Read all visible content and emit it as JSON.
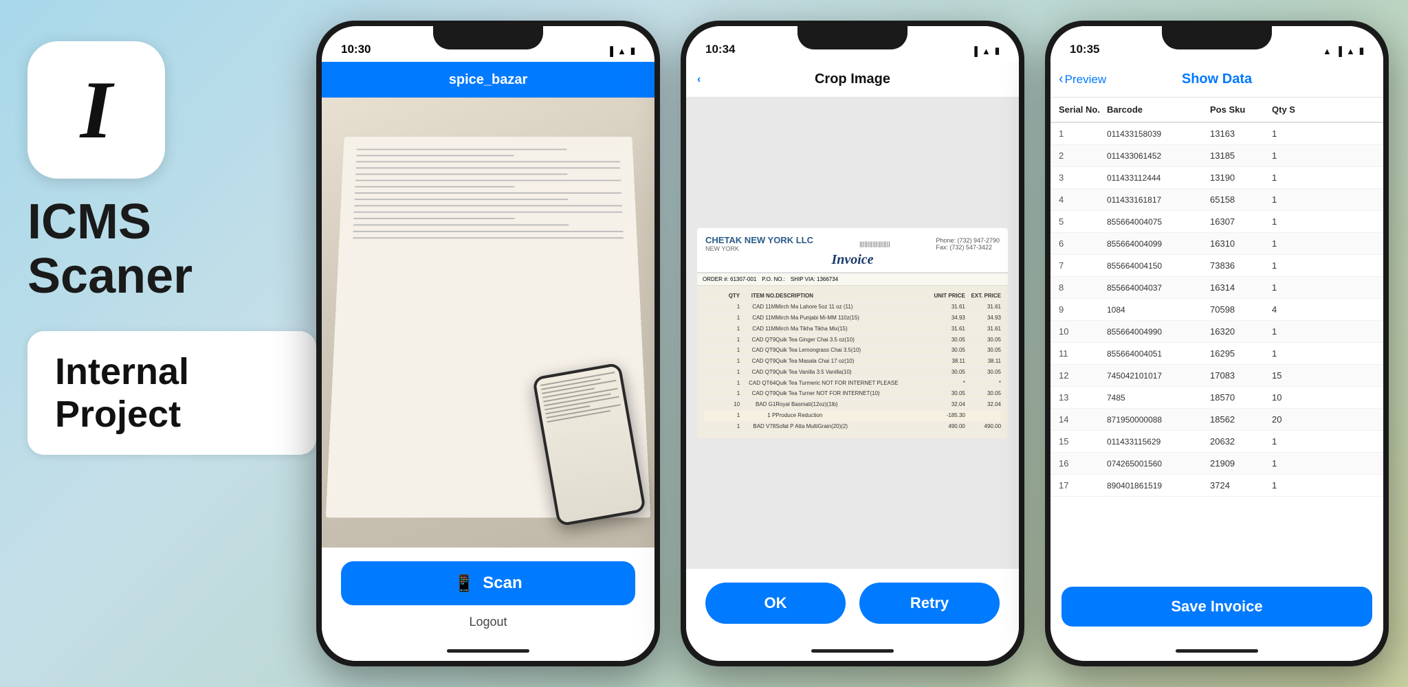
{
  "background": "#b8d4d8",
  "app": {
    "icon_letter": "I",
    "name": "ICMS\nScaner",
    "badge": "Internal Project"
  },
  "phone1": {
    "time": "10:30",
    "nav_title": "spice_bazar",
    "scan_button": "Scan",
    "logout": "Logout"
  },
  "phone2": {
    "time": "10:34",
    "nav_title": "Crop Image",
    "ok_button": "OK",
    "retry_button": "Retry"
  },
  "phone3": {
    "time": "10:35",
    "nav_back": "Preview",
    "nav_title": "Show Data",
    "columns": [
      "Serial No.",
      "Barcode",
      "Pos Sku",
      "Qty S"
    ],
    "rows": [
      {
        "serial": "1",
        "barcode": "011433158039",
        "pos": "13163",
        "qty": "1"
      },
      {
        "serial": "2",
        "barcode": "011433061452",
        "pos": "13185",
        "qty": "1"
      },
      {
        "serial": "3",
        "barcode": "011433112444",
        "pos": "13190",
        "qty": "1"
      },
      {
        "serial": "4",
        "barcode": "011433161817",
        "pos": "65158",
        "qty": "1"
      },
      {
        "serial": "5",
        "barcode": "855664004075",
        "pos": "16307",
        "qty": "1"
      },
      {
        "serial": "6",
        "barcode": "855664004099",
        "pos": "16310",
        "qty": "1"
      },
      {
        "serial": "7",
        "barcode": "855664004150",
        "pos": "73836",
        "qty": "1"
      },
      {
        "serial": "8",
        "barcode": "855664004037",
        "pos": "16314",
        "qty": "1"
      },
      {
        "serial": "9",
        "barcode": "1084",
        "pos": "70598",
        "qty": "4"
      },
      {
        "serial": "10",
        "barcode": "855664004990",
        "pos": "16320",
        "qty": "1"
      },
      {
        "serial": "11",
        "barcode": "855664004051",
        "pos": "16295",
        "qty": "1"
      },
      {
        "serial": "12",
        "barcode": "745042101017",
        "pos": "17083",
        "qty": "15"
      },
      {
        "serial": "13",
        "barcode": "7485",
        "pos": "18570",
        "qty": "10"
      },
      {
        "serial": "14",
        "barcode": "871950000088",
        "pos": "18562",
        "qty": "20"
      },
      {
        "serial": "15",
        "barcode": "011433115629",
        "pos": "20632",
        "qty": "1"
      },
      {
        "serial": "16",
        "barcode": "074265001560",
        "pos": "21909",
        "qty": "1"
      },
      {
        "serial": "17",
        "barcode": "890401861519",
        "pos": "3724",
        "qty": "1"
      }
    ],
    "save_button": "Save Invoice"
  },
  "invoice": {
    "company": "CHETAK NEW YORK LLC",
    "title": "Invoice",
    "items": [
      {
        "qty": "1",
        "item": "CAD 11M Mirch Ma Lahore 5oz 11 oz (11)",
        "price": "31.61"
      },
      {
        "qty": "1",
        "item": "CAD 11M Mirch Ma Punjabi Mi-MM 11oz(15)",
        "price": "34.93"
      },
      {
        "qty": "1",
        "item": "CAD 11M Mirch Ma Tikha Tikha Mix(15)",
        "price": "31.61"
      },
      {
        "qty": "1",
        "item": "CAD QT9 Quik Tea Ginger Chai 3.5 oz(10)",
        "price": "30.05"
      },
      {
        "qty": "1",
        "item": "CAD QT9 Quik Tea Lemongrass Chai 3.5(10)",
        "price": "30.05"
      },
      {
        "qty": "1",
        "item": "CAD QT9 Quik Tea Masala Chai 17 oz(10)",
        "price": "38.11"
      },
      {
        "qty": "1",
        "item": "CAD QT9 Quik Tea Vanilla 3.5 oz Vanilla(10)",
        "price": "30.05"
      }
    ]
  }
}
